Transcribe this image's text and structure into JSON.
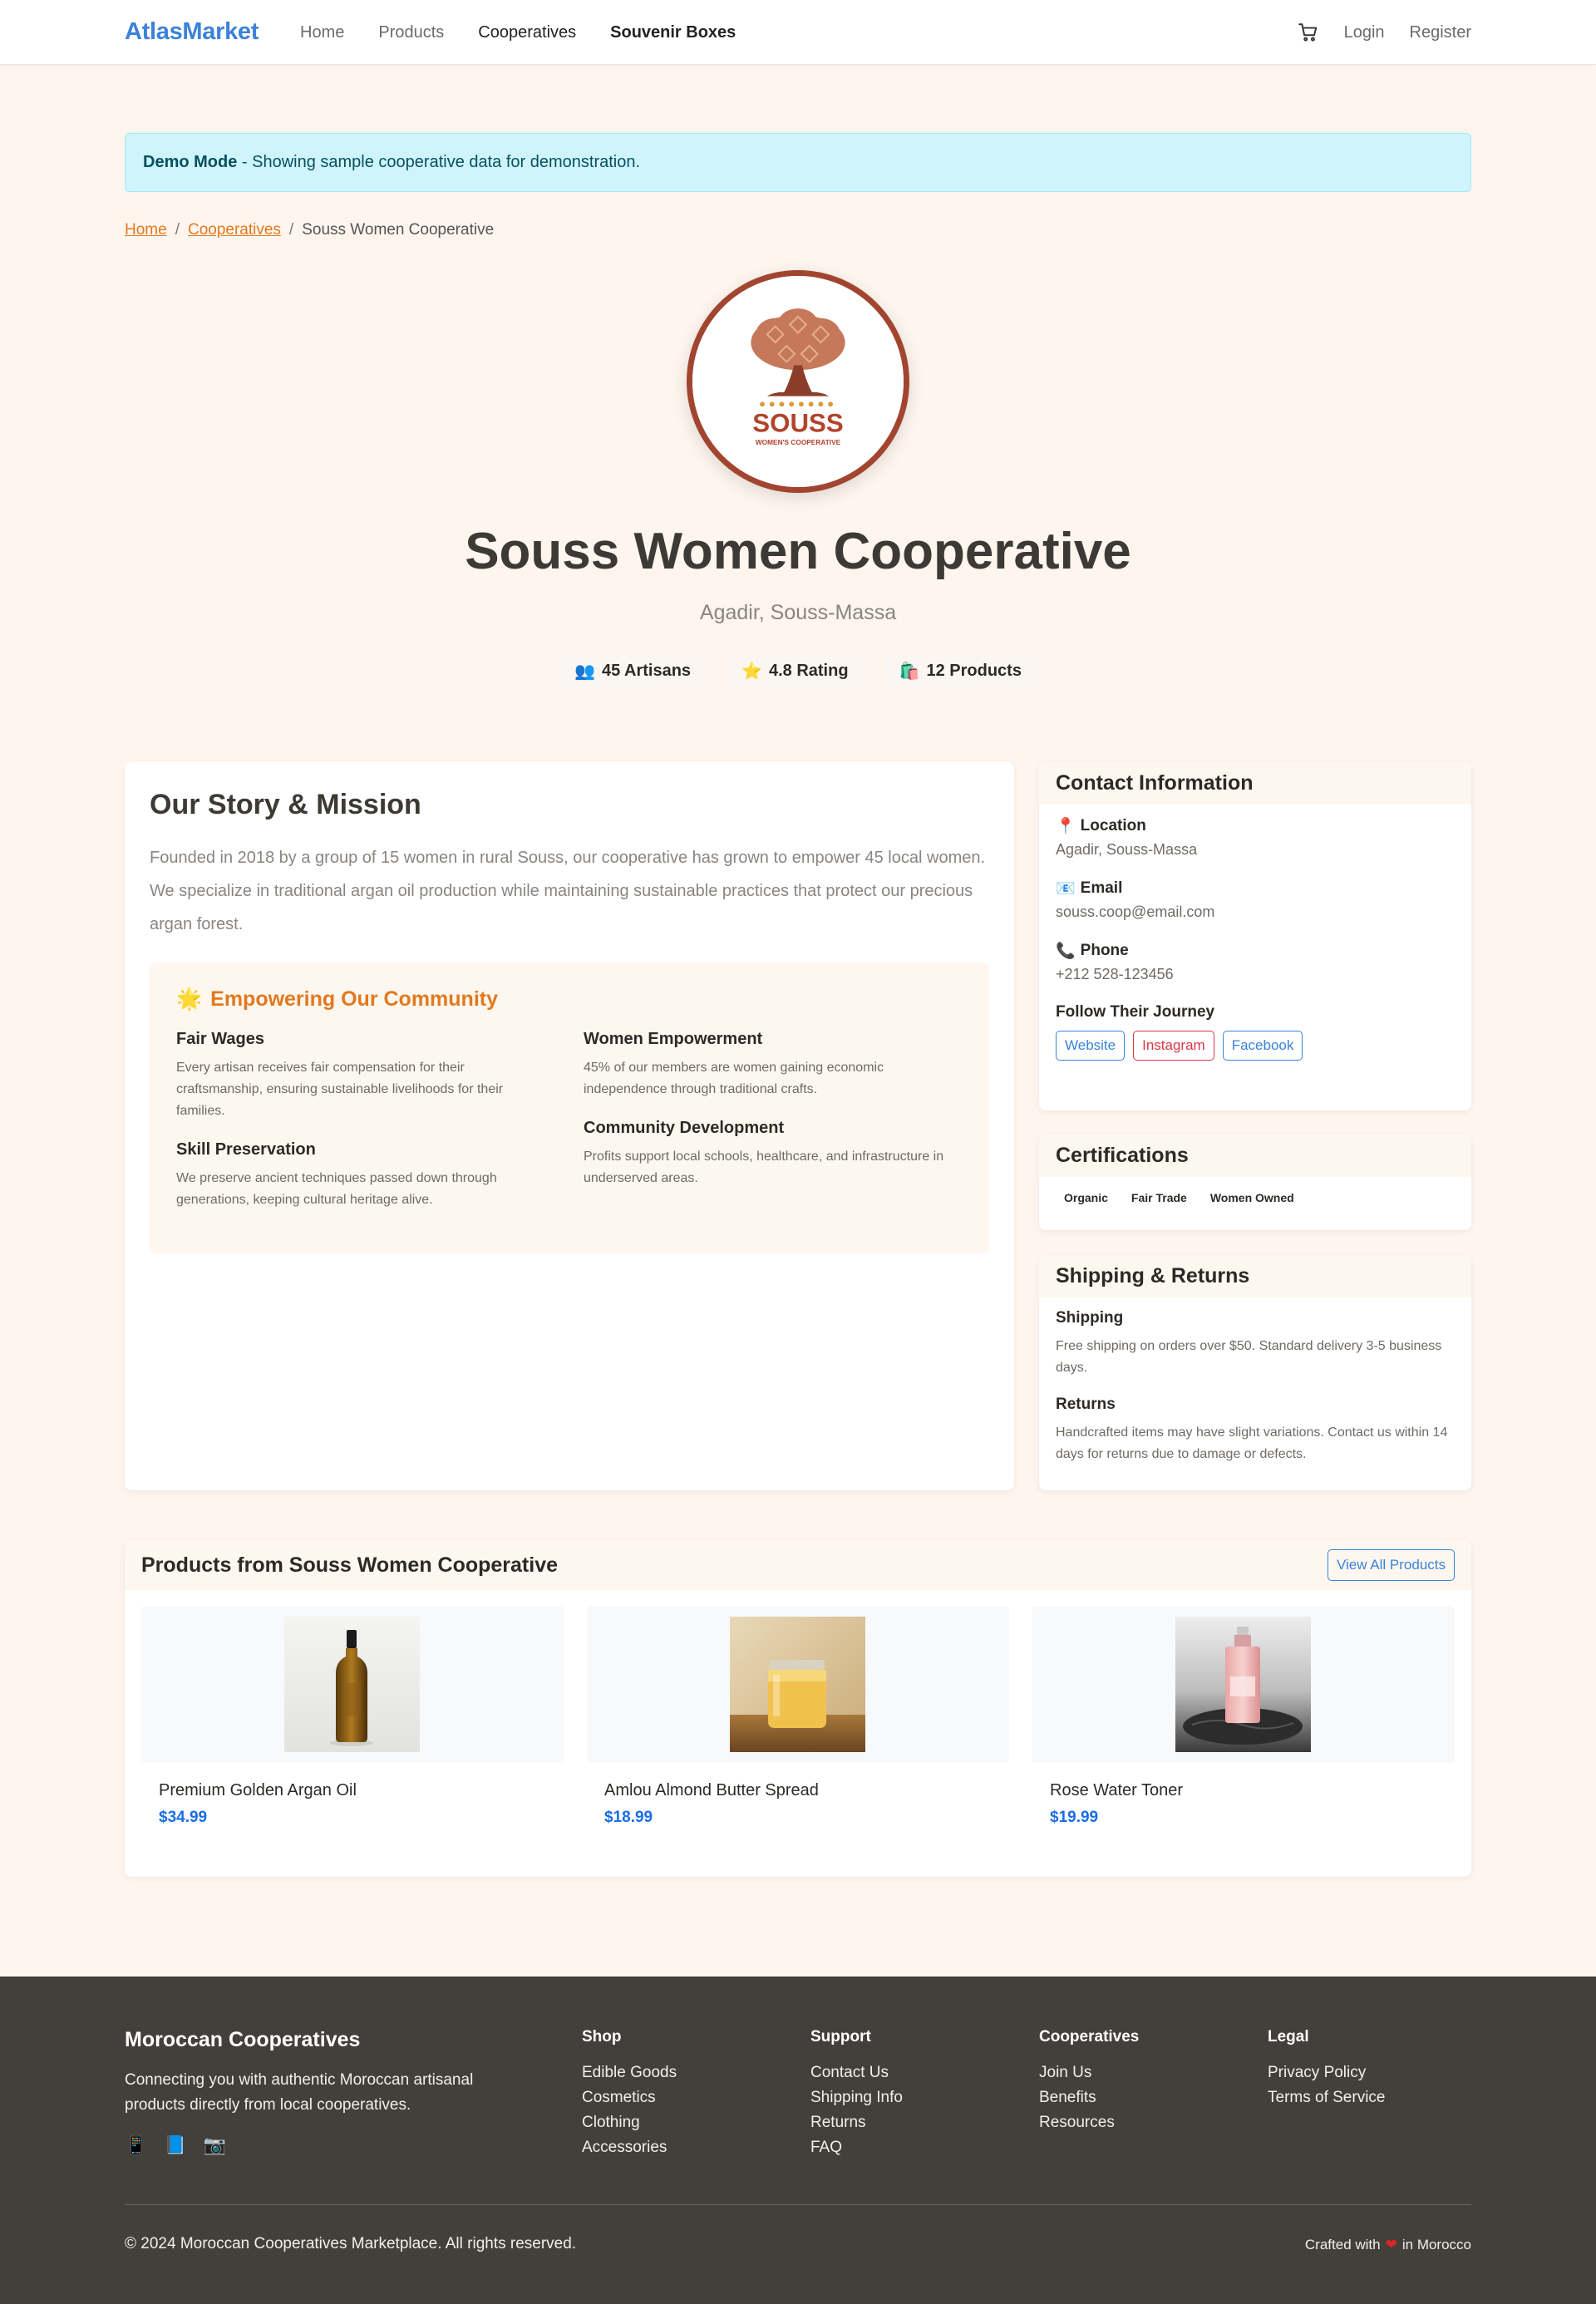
{
  "nav": {
    "brand": "AtlasMarket",
    "links": [
      "Home",
      "Products",
      "Cooperatives",
      "Souvenir Boxes"
    ],
    "login": "Login",
    "register": "Register"
  },
  "alert": {
    "bold": "Demo Mode",
    "text": " - Showing sample cooperative data for demonstration."
  },
  "breadcrumb": {
    "home": "Home",
    "cooperatives": "Cooperatives",
    "current": "Souss Women Cooperative",
    "separator": "/"
  },
  "logo": {
    "name": "SOUSS",
    "subtitle": "WOMEN'S COOPERATIVE"
  },
  "hero": {
    "title": "Souss Women Cooperative",
    "location": "Agadir, Souss-Massa",
    "stats": [
      {
        "icon": "👥",
        "label": "45 Artisans"
      },
      {
        "icon": "⭐",
        "label": "4.8 Rating"
      },
      {
        "icon": "🛍️",
        "label": "12 Products"
      }
    ]
  },
  "story": {
    "title": "Our Story & Mission",
    "text": "Founded in 2018 by a group of 15 women in rural Souss, our cooperative has grown to empower 45 local women. We specialize in traditional argan oil production while maintaining sustainable practices that protect our precious argan forest.",
    "community_icon": "🌟",
    "community_title": "Empowering Our Community",
    "items": [
      {
        "title": "Fair Wages",
        "text": "Every artisan receives fair compensation for their craftsmanship, ensuring sustainable livelihoods for their families."
      },
      {
        "title": "Women Empowerment",
        "text": "45% of our members are women gaining economic independence through traditional crafts."
      },
      {
        "title": "Skill Preservation",
        "text": "We preserve ancient techniques passed down through generations, keeping cultural heritage alive."
      },
      {
        "title": "Community Development",
        "text": "Profits support local schools, healthcare, and infrastructure in underserved areas."
      }
    ]
  },
  "contact": {
    "title": "Contact Information",
    "location_icon": "📍",
    "location_label": "Location",
    "location_value": "Agadir, Souss-Massa",
    "email_icon": "📧",
    "email_label": "Email",
    "email_value": "souss.coop@email.com",
    "phone_icon": "📞",
    "phone_label": "Phone",
    "phone_value": "+212 528-123456",
    "follow_title": "Follow Their Journey",
    "social": [
      "Website",
      "Instagram",
      "Facebook"
    ]
  },
  "certifications": {
    "title": "Certifications",
    "badges": [
      "Organic",
      "Fair Trade",
      "Women Owned"
    ]
  },
  "shipping": {
    "title": "Shipping & Returns",
    "shipping_title": "Shipping",
    "shipping_text": "Free shipping on orders over $50. Standard delivery 3-5 business days.",
    "returns_title": "Returns",
    "returns_text": "Handcrafted items may have slight variations. Contact us within 14 days for returns due to damage or defects."
  },
  "products": {
    "title": "Products from Souss Women Cooperative",
    "view_all": "View All Products",
    "items": [
      {
        "name": "Premium Golden Argan Oil",
        "price": "$34.99"
      },
      {
        "name": "Amlou Almond Butter Spread",
        "price": "$18.99"
      },
      {
        "name": "Rose Water Toner",
        "price": "$19.99"
      }
    ]
  },
  "footer": {
    "brand": "Moroccan Cooperatives",
    "desc": "Connecting you with authentic Moroccan artisanal products directly from local cooperatives.",
    "icons": [
      "📱",
      "📘",
      "📷"
    ],
    "columns": [
      {
        "title": "Shop",
        "links": [
          "Edible Goods",
          "Cosmetics",
          "Clothing",
          "Accessories"
        ]
      },
      {
        "title": "Support",
        "links": [
          "Contact Us",
          "Shipping Info",
          "Returns",
          "FAQ"
        ]
      },
      {
        "title": "Cooperatives",
        "links": [
          "Join Us",
          "Benefits",
          "Resources"
        ]
      },
      {
        "title": "Legal",
        "links": [
          "Privacy Policy",
          "Terms of Service"
        ]
      }
    ],
    "copyright": "© 2024 Moroccan Cooperatives Marketplace. All rights reserved.",
    "crafted_pre": "Crafted with",
    "crafted_heart": "❤",
    "crafted_post": "in Morocco"
  }
}
